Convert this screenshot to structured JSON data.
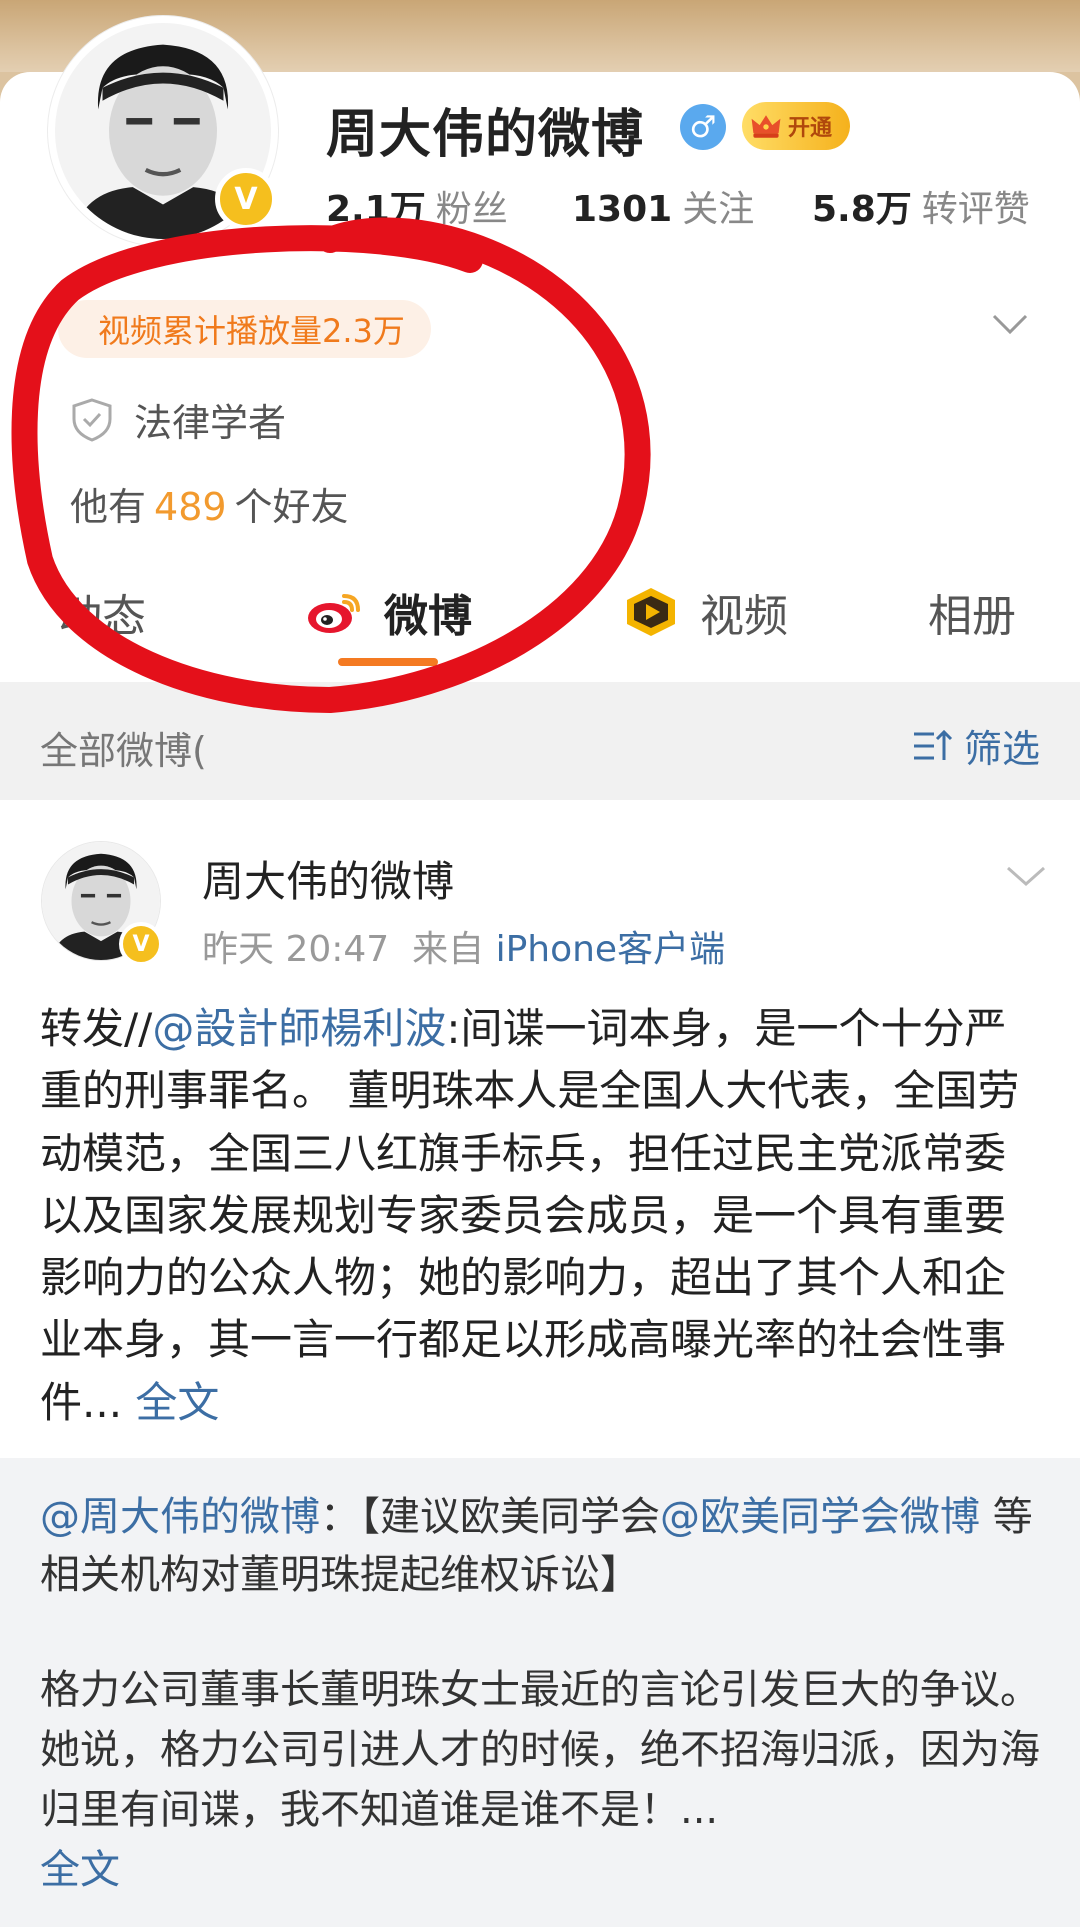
{
  "profile": {
    "name": "周大伟的微博",
    "gender_symbol": "♂",
    "vip_label": "开通",
    "verified_symbol": "V",
    "stats": {
      "fans_count": "2.1万",
      "fans_label": "粉丝",
      "following_count": "1301",
      "following_label": "关注",
      "likes_count": "5.8万",
      "likes_label": "转评赞"
    },
    "video_plays": "视频累计播放量2.3万",
    "verification": "法律学者",
    "friends_prefix": "他有",
    "friends_count": "489",
    "friends_suffix": "个好友"
  },
  "tabs": [
    {
      "label": "动态"
    },
    {
      "label": "微博",
      "active": true
    },
    {
      "label": "视频"
    },
    {
      "label": "相册"
    }
  ],
  "filter": {
    "label": "全部微博(",
    "button_label": "筛选"
  },
  "post": {
    "author": "周大伟的微博",
    "time": "昨天 20:47",
    "from_label": "来自",
    "source": "iPhone客户端",
    "text_prefix": "转发//",
    "mention": "@設計師楊利波",
    "text": ":间谍一词本身，是一个十分严重的刑事罪名。 董明珠本人是全国人大代表，全国劳动模范，全国三八红旗手标兵，担任过民主党派常委以及国家发展规划专家委员会成员，是一个具有重要影响力的公众人物；她的影响力，超出了其个人和企业本身，其一言一行都足以形成高曝光率的社会性事件... ",
    "full_text_link": "全文",
    "repost": {
      "mention": "@周大伟的微博",
      "separator": "：【建议欧美同学会",
      "mention2": "@欧美同学会微博",
      "title_rest": " 等相关机构对董明珠提起维权诉讼】",
      "body": "格力公司董事长董明珠女士最近的言论引发巨大的争议。她说，格力公司引进人才的时候，绝不招海归派，因为海归里有间谍，我不知道谁是谁不是！...",
      "full_text_link": "全文"
    }
  },
  "colors": {
    "accent_orange": "#f47a22",
    "link_blue": "#3c6ea4",
    "annotation_red": "#e4101a",
    "vip_gold": "#f5bf1e"
  },
  "icons": [
    "gender-male-icon",
    "crown-icon",
    "verified-badge-icon",
    "chevron-down-icon",
    "shield-icon",
    "weibo-logo-icon",
    "video-play-icon",
    "filter-icon"
  ]
}
